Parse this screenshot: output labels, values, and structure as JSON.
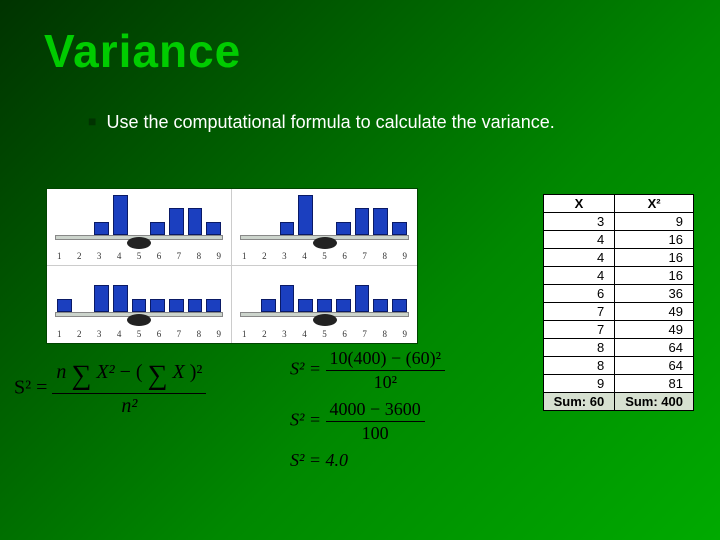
{
  "title": "Variance",
  "bullet": "Use the computational formula to calculate the variance.",
  "chart_data": [
    {
      "type": "bar",
      "categories": [
        "1",
        "2",
        "3",
        "4",
        "5",
        "6",
        "7",
        "8",
        "9"
      ],
      "values": [
        0,
        0,
        1,
        3,
        0,
        1,
        2,
        2,
        1
      ],
      "ylim": [
        0,
        3
      ]
    },
    {
      "type": "bar",
      "categories": [
        "1",
        "2",
        "3",
        "4",
        "5",
        "6",
        "7",
        "8",
        "9"
      ],
      "values": [
        0,
        0,
        1,
        3,
        0,
        1,
        2,
        2,
        1
      ],
      "ylim": [
        0,
        3
      ]
    },
    {
      "type": "bar",
      "categories": [
        "1",
        "2",
        "3",
        "4",
        "5",
        "6",
        "7",
        "8",
        "9"
      ],
      "values": [
        1,
        0,
        2,
        2,
        1,
        1,
        1,
        1,
        1
      ],
      "ylim": [
        0,
        3
      ]
    },
    {
      "type": "bar",
      "categories": [
        "1",
        "2",
        "3",
        "4",
        "5",
        "6",
        "7",
        "8",
        "9"
      ],
      "values": [
        0,
        1,
        2,
        1,
        1,
        1,
        2,
        1,
        1
      ],
      "ylim": [
        0,
        3
      ]
    }
  ],
  "table": {
    "headers": [
      "X",
      "X²"
    ],
    "rows": [
      [
        3,
        9
      ],
      [
        4,
        16
      ],
      [
        4,
        16
      ],
      [
        4,
        16
      ],
      [
        6,
        36
      ],
      [
        7,
        49
      ],
      [
        7,
        49
      ],
      [
        8,
        64
      ],
      [
        8,
        64
      ],
      [
        9,
        81
      ]
    ],
    "sums": [
      "Sum: 60",
      "Sum: 400"
    ]
  },
  "formula": {
    "lhs": "S² =",
    "gen_num_a": "n",
    "gen_sum1": "∑",
    "gen_x2": "X²",
    "gen_minus": " − (",
    "gen_sum2": "∑",
    "gen_x": "X",
    "gen_close": ")²",
    "gen_den": "n²",
    "step1_num": "10(400) − (60)²",
    "step1_den": "10²",
    "step2_num": "4000 − 3600",
    "step2_den": "100",
    "result": "S² = 4.0"
  }
}
